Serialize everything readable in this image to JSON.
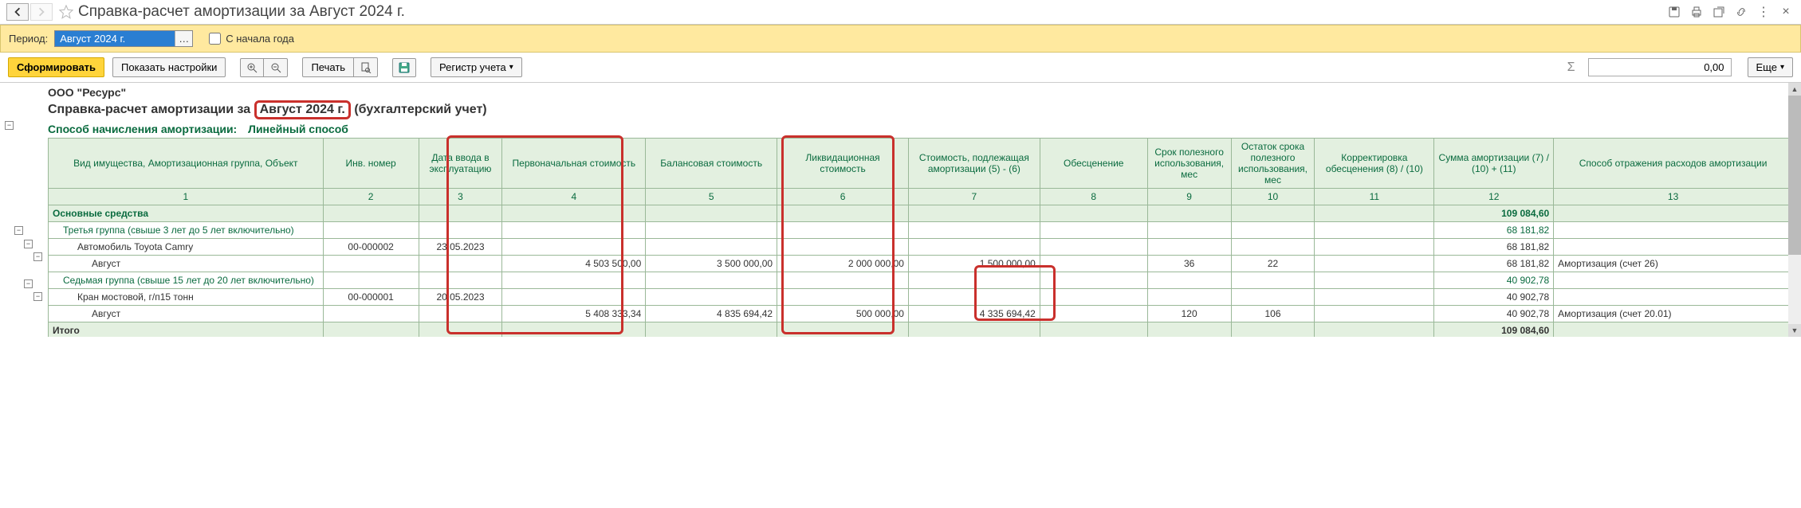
{
  "title": "Справка-расчет амортизации за Август 2024 г.",
  "period": {
    "label": "Период:",
    "value": "Август 2024 г.",
    "from_start_label": "С начала года"
  },
  "toolbar": {
    "generate": "Сформировать",
    "show_settings": "Показать настройки",
    "print": "Печать",
    "register": "Регистр учета",
    "sum_value": "0,00",
    "more": "Еще"
  },
  "report": {
    "org": "ООО \"Ресурс\"",
    "title_prefix": "Справка-расчет амортизации за",
    "title_period": "Август 2024 г.",
    "title_suffix": "(бухгалтерский учет)",
    "method_label": "Способ начисления амортизации:",
    "method_value": "Линейный способ",
    "headers": [
      "Вид имущества,\nАмортизационная группа,\nОбъект",
      "Инв. номер",
      "Дата ввода в эксплуатацию",
      "Первоначальная стоимость",
      "Балансовая стоимость",
      "Ликвидационная стоимость",
      "Стоимость, подлежащая амортизации\n(5) - (6)",
      "Обесценение",
      "Срок полезного использования, мес",
      "Остаток срока полезного использования, мес",
      "Корректировка обесценения\n(8) / (10)",
      "Сумма амортизации\n(7) / (10)\n+ (11)",
      "Способ отражения расходов амортизации"
    ],
    "col_nums": [
      "1",
      "2",
      "3",
      "4",
      "5",
      "6",
      "7",
      "8",
      "9",
      "10",
      "11",
      "12",
      "13"
    ],
    "section": {
      "label": "Основные средства",
      "col12": "109 084,60"
    },
    "group3": {
      "label": "Третья группа (свыше 3 лет до 5 лет включительно)",
      "col12": "68 181,82"
    },
    "item1": {
      "label": "Автомобиль Toyota Camry",
      "inv": "00-000002",
      "date": "23.05.2023",
      "col12": "68 181,82"
    },
    "item1_month": {
      "label": "Август",
      "c4": "4 503 500,00",
      "c5": "3 500 000,00",
      "c6": "2 000 000,00",
      "c7": "1 500 000,00",
      "c9": "36",
      "c10": "22",
      "c12": "68 181,82",
      "c13": "Амортизация (счет 26)"
    },
    "group7": {
      "label": "Седьмая группа (свыше 15 лет до 20 лет включительно)",
      "col12": "40 902,78"
    },
    "item2": {
      "label": "Кран мостовой, г/п15 тонн",
      "inv": "00-000001",
      "date": "20.05.2023",
      "col12": "40 902,78"
    },
    "item2_month": {
      "label": "Август",
      "c4": "5 408 333,34",
      "c5": "4 835 694,42",
      "c6": "500 000,00",
      "c7": "4 335 694,42",
      "c9": "120",
      "c10": "106",
      "c12": "40 902,78",
      "c13": "Амортизация (счет 20.01)"
    },
    "total": {
      "label": "Итого",
      "col12": "109 084,60"
    }
  }
}
